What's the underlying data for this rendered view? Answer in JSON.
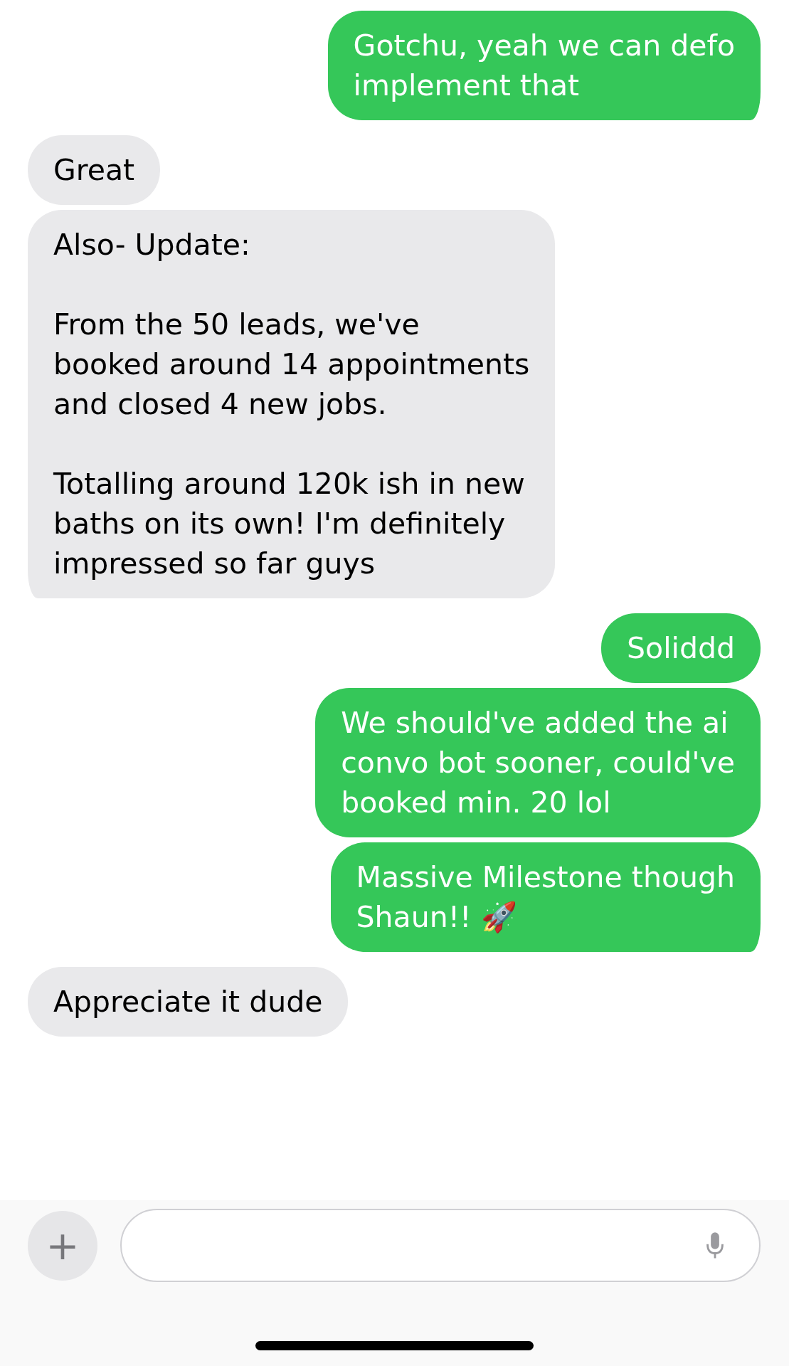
{
  "messages": [
    {
      "kind": "sent",
      "text": "Gotchu, yeah we can defo\nimplement that",
      "tail": true
    },
    {
      "kind": "received",
      "text": "Great",
      "tail": false
    },
    {
      "kind": "received",
      "text": "Also- Update:\n\nFrom the 50 leads, we've\nbooked around 14 appointments\nand closed 4 new jobs.\n\nTotalling around 120k ish in new\nbaths on its own! I'm definitely\nimpressed so far guys",
      "tail": true
    },
    {
      "kind": "sent",
      "text": "Soliddd",
      "tail": false
    },
    {
      "kind": "sent",
      "text": "We should've added the ai\nconvo bot sooner, could've\nbooked min. 20 lol",
      "tail": false
    },
    {
      "kind": "sent",
      "text": "Massive Milestone though\nShaun!! 🚀",
      "tail": true
    },
    {
      "kind": "received",
      "text": "Appreciate it dude",
      "tail": false
    }
  ],
  "composer": {
    "add_button": "+"
  }
}
